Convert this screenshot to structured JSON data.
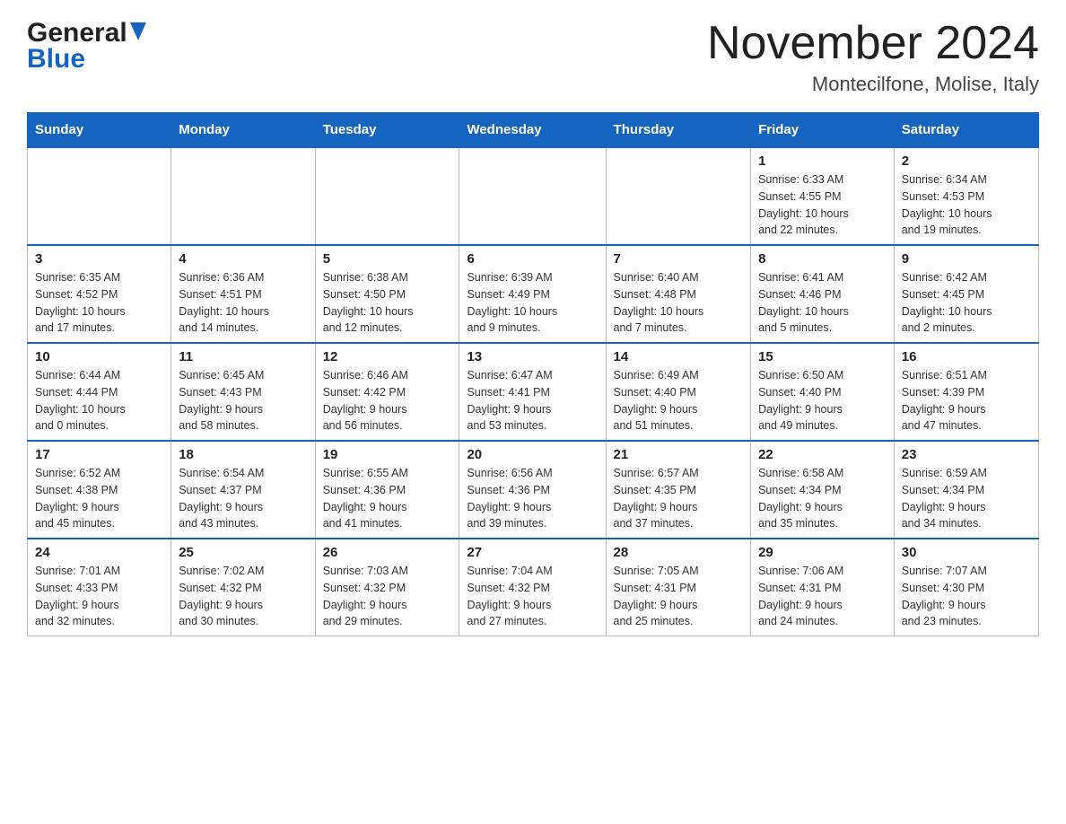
{
  "header": {
    "logo_general": "General",
    "logo_blue": "Blue",
    "month_title": "November 2024",
    "location": "Montecilfone, Molise, Italy"
  },
  "weekdays": [
    "Sunday",
    "Monday",
    "Tuesday",
    "Wednesday",
    "Thursday",
    "Friday",
    "Saturday"
  ],
  "weeks": [
    [
      {
        "day": "",
        "info": ""
      },
      {
        "day": "",
        "info": ""
      },
      {
        "day": "",
        "info": ""
      },
      {
        "day": "",
        "info": ""
      },
      {
        "day": "",
        "info": ""
      },
      {
        "day": "1",
        "info": "Sunrise: 6:33 AM\nSunset: 4:55 PM\nDaylight: 10 hours\nand 22 minutes."
      },
      {
        "day": "2",
        "info": "Sunrise: 6:34 AM\nSunset: 4:53 PM\nDaylight: 10 hours\nand 19 minutes."
      }
    ],
    [
      {
        "day": "3",
        "info": "Sunrise: 6:35 AM\nSunset: 4:52 PM\nDaylight: 10 hours\nand 17 minutes."
      },
      {
        "day": "4",
        "info": "Sunrise: 6:36 AM\nSunset: 4:51 PM\nDaylight: 10 hours\nand 14 minutes."
      },
      {
        "day": "5",
        "info": "Sunrise: 6:38 AM\nSunset: 4:50 PM\nDaylight: 10 hours\nand 12 minutes."
      },
      {
        "day": "6",
        "info": "Sunrise: 6:39 AM\nSunset: 4:49 PM\nDaylight: 10 hours\nand 9 minutes."
      },
      {
        "day": "7",
        "info": "Sunrise: 6:40 AM\nSunset: 4:48 PM\nDaylight: 10 hours\nand 7 minutes."
      },
      {
        "day": "8",
        "info": "Sunrise: 6:41 AM\nSunset: 4:46 PM\nDaylight: 10 hours\nand 5 minutes."
      },
      {
        "day": "9",
        "info": "Sunrise: 6:42 AM\nSunset: 4:45 PM\nDaylight: 10 hours\nand 2 minutes."
      }
    ],
    [
      {
        "day": "10",
        "info": "Sunrise: 6:44 AM\nSunset: 4:44 PM\nDaylight: 10 hours\nand 0 minutes."
      },
      {
        "day": "11",
        "info": "Sunrise: 6:45 AM\nSunset: 4:43 PM\nDaylight: 9 hours\nand 58 minutes."
      },
      {
        "day": "12",
        "info": "Sunrise: 6:46 AM\nSunset: 4:42 PM\nDaylight: 9 hours\nand 56 minutes."
      },
      {
        "day": "13",
        "info": "Sunrise: 6:47 AM\nSunset: 4:41 PM\nDaylight: 9 hours\nand 53 minutes."
      },
      {
        "day": "14",
        "info": "Sunrise: 6:49 AM\nSunset: 4:40 PM\nDaylight: 9 hours\nand 51 minutes."
      },
      {
        "day": "15",
        "info": "Sunrise: 6:50 AM\nSunset: 4:40 PM\nDaylight: 9 hours\nand 49 minutes."
      },
      {
        "day": "16",
        "info": "Sunrise: 6:51 AM\nSunset: 4:39 PM\nDaylight: 9 hours\nand 47 minutes."
      }
    ],
    [
      {
        "day": "17",
        "info": "Sunrise: 6:52 AM\nSunset: 4:38 PM\nDaylight: 9 hours\nand 45 minutes."
      },
      {
        "day": "18",
        "info": "Sunrise: 6:54 AM\nSunset: 4:37 PM\nDaylight: 9 hours\nand 43 minutes."
      },
      {
        "day": "19",
        "info": "Sunrise: 6:55 AM\nSunset: 4:36 PM\nDaylight: 9 hours\nand 41 minutes."
      },
      {
        "day": "20",
        "info": "Sunrise: 6:56 AM\nSunset: 4:36 PM\nDaylight: 9 hours\nand 39 minutes."
      },
      {
        "day": "21",
        "info": "Sunrise: 6:57 AM\nSunset: 4:35 PM\nDaylight: 9 hours\nand 37 minutes."
      },
      {
        "day": "22",
        "info": "Sunrise: 6:58 AM\nSunset: 4:34 PM\nDaylight: 9 hours\nand 35 minutes."
      },
      {
        "day": "23",
        "info": "Sunrise: 6:59 AM\nSunset: 4:34 PM\nDaylight: 9 hours\nand 34 minutes."
      }
    ],
    [
      {
        "day": "24",
        "info": "Sunrise: 7:01 AM\nSunset: 4:33 PM\nDaylight: 9 hours\nand 32 minutes."
      },
      {
        "day": "25",
        "info": "Sunrise: 7:02 AM\nSunset: 4:32 PM\nDaylight: 9 hours\nand 30 minutes."
      },
      {
        "day": "26",
        "info": "Sunrise: 7:03 AM\nSunset: 4:32 PM\nDaylight: 9 hours\nand 29 minutes."
      },
      {
        "day": "27",
        "info": "Sunrise: 7:04 AM\nSunset: 4:32 PM\nDaylight: 9 hours\nand 27 minutes."
      },
      {
        "day": "28",
        "info": "Sunrise: 7:05 AM\nSunset: 4:31 PM\nDaylight: 9 hours\nand 25 minutes."
      },
      {
        "day": "29",
        "info": "Sunrise: 7:06 AM\nSunset: 4:31 PM\nDaylight: 9 hours\nand 24 minutes."
      },
      {
        "day": "30",
        "info": "Sunrise: 7:07 AM\nSunset: 4:30 PM\nDaylight: 9 hours\nand 23 minutes."
      }
    ]
  ]
}
